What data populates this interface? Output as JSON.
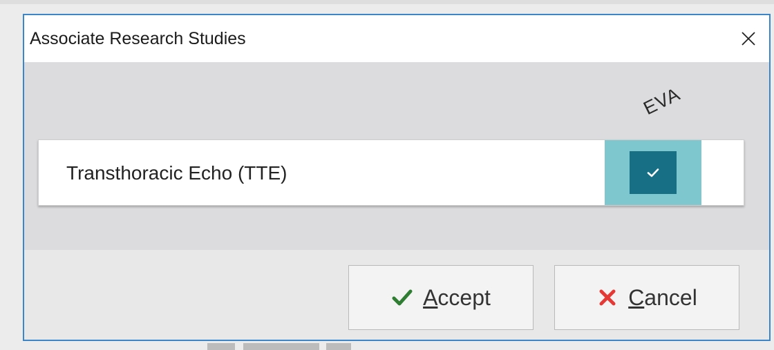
{
  "dialog": {
    "title": "Associate Research Studies",
    "close_icon": "close-icon"
  },
  "grid": {
    "column_header": "EVA",
    "rows": [
      {
        "label": "Transthoracic Echo (TTE)",
        "checked": true
      }
    ]
  },
  "buttons": {
    "accept": {
      "mnemonic": "A",
      "rest": "ccept",
      "icon": "checkmark-icon",
      "icon_color": "#2e7d32"
    },
    "cancel": {
      "mnemonic": "C",
      "rest": "ancel",
      "icon": "x-icon",
      "icon_color": "#e53935"
    }
  },
  "colors": {
    "accent_border": "#3a86c8",
    "check_cell_bg": "#7fc7cf",
    "checkbox_fill": "#176f85"
  }
}
